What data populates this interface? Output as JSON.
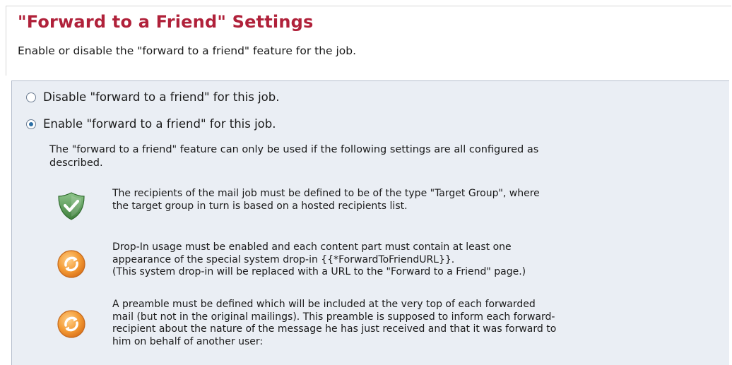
{
  "header": {
    "title": "\"Forward to a Friend\" Settings",
    "subtitle": "Enable or disable the \"forward to a friend\" feature for the job."
  },
  "options": [
    {
      "label": "Disable \"forward to a friend\" for this job.",
      "selected": false
    },
    {
      "label": "Enable \"forward to a friend\" for this job.",
      "selected": true
    }
  ],
  "note": {
    "line1": "The \"forward to a friend\" feature can only be used if the following settings are all configured as",
    "line2": "described."
  },
  "requirements": [
    {
      "icon": "shield-check-icon",
      "color": "#5e9e5a",
      "lines": [
        "The recipients of the mail job must be defined to be of the type \"Target Group\", where",
        "the target group in turn is based on a hosted recipients list."
      ]
    },
    {
      "icon": "refresh-warning-icon",
      "color": "#f0922e",
      "lines": [
        "Drop-In usage must be enabled and each content part must contain at least one",
        "appearance of the special system drop-in {{*ForwardToFriendURL}}.",
        "(This system drop-in will be replaced with a URL to the \"Forward to a Friend\" page.)"
      ]
    },
    {
      "icon": "refresh-warning-icon",
      "color": "#f0922e",
      "lines": [
        "A preamble must be defined which will be included at the very top of each forwarded",
        "mail (but not in the original mailings). This preamble is supposed to inform each forward-",
        "recipient about the nature of the message he has just received and that it was forward to",
        "him on behalf of another user:"
      ]
    }
  ],
  "colors": {
    "title": "#b0213a",
    "panel_background": "#eaeef4",
    "panel_border": "#b3bccb"
  }
}
